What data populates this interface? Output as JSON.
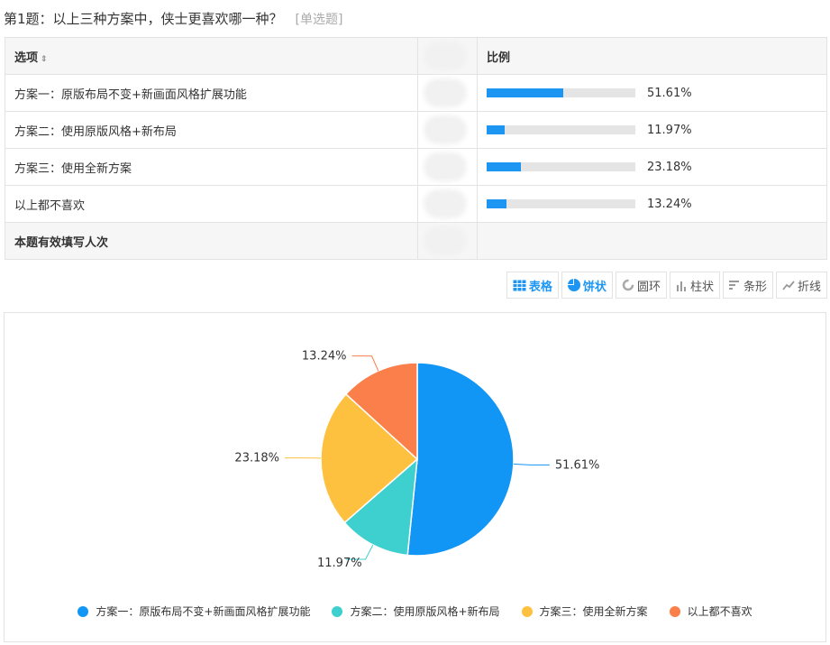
{
  "question": {
    "title": "第1题：以上三种方案中，侠士更喜欢哪一种？",
    "type_tag": "[单选题]"
  },
  "table": {
    "header_option": "选项",
    "header_ratio": "比例",
    "sort_icon": "sort-arrows-icon",
    "rows": [
      {
        "option": "方案一：原版布局不变+新画面风格扩展功能",
        "percent_label": "51.61%",
        "percent": 51.61
      },
      {
        "option": "方案二：使用原版风格+新布局",
        "percent_label": "11.97%",
        "percent": 11.97
      },
      {
        "option": "方案三：使用全新方案",
        "percent_label": "23.18%",
        "percent": 23.18
      },
      {
        "option": "以上都不喜欢",
        "percent_label": "13.24%",
        "percent": 13.24
      }
    ],
    "total_label": "本题有效填写人次"
  },
  "toolbar": {
    "buttons": [
      {
        "label": "表格",
        "icon": "table-icon",
        "active": true
      },
      {
        "label": "饼状",
        "icon": "pie-icon",
        "active": true
      },
      {
        "label": "圆环",
        "icon": "ring-icon",
        "active": false
      },
      {
        "label": "柱状",
        "icon": "column-icon",
        "active": false
      },
      {
        "label": "条形",
        "icon": "bar-icon",
        "active": false
      },
      {
        "label": "折线",
        "icon": "line-icon",
        "active": false
      }
    ]
  },
  "chart_data": {
    "type": "pie",
    "categories": [
      "方案一：原版布局不变+新画面风格扩展功能",
      "方案二：使用原版风格+新布局",
      "方案三：使用全新方案",
      "以上都不喜欢"
    ],
    "values": [
      51.61,
      11.97,
      23.18,
      13.24
    ],
    "labels": [
      "51.61%",
      "11.97%",
      "23.18%",
      "13.24%"
    ],
    "colors": [
      "#1296f5",
      "#3ecfcf",
      "#fec13f",
      "#fb7f4a"
    ],
    "legend_position": "bottom"
  },
  "colors": {
    "accent": "#1d96f3",
    "bar_track": "#e5e5e5",
    "border": "#e3e3e3"
  }
}
